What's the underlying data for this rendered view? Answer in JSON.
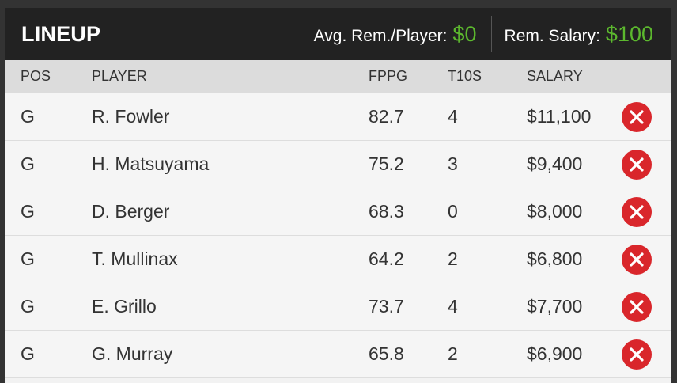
{
  "header": {
    "title": "LINEUP",
    "avg_label": "Avg. Rem./Player:",
    "avg_value": "$0",
    "rem_label": "Rem. Salary:",
    "rem_value": "$100",
    "accent_color": "#5cb82e"
  },
  "columns": {
    "pos": "POS",
    "player": "PLAYER",
    "fppg": "FPPG",
    "t10s": "T10S",
    "salary": "SALARY"
  },
  "rows": [
    {
      "pos": "G",
      "player": "R. Fowler",
      "fppg": "82.7",
      "t10s": "4",
      "salary": "$11,100"
    },
    {
      "pos": "G",
      "player": "H. Matsuyama",
      "fppg": "75.2",
      "t10s": "3",
      "salary": "$9,400"
    },
    {
      "pos": "G",
      "player": "D. Berger",
      "fppg": "68.3",
      "t10s": "0",
      "salary": "$8,000"
    },
    {
      "pos": "G",
      "player": "T. Mullinax",
      "fppg": "64.2",
      "t10s": "2",
      "salary": "$6,800"
    },
    {
      "pos": "G",
      "player": "E. Grillo",
      "fppg": "73.7",
      "t10s": "4",
      "salary": "$7,700"
    },
    {
      "pos": "G",
      "player": "G. Murray",
      "fppg": "65.8",
      "t10s": "2",
      "salary": "$6,900"
    }
  ],
  "icons": {
    "remove": "remove-x-circle-icon",
    "remove_color": "#d9262b"
  }
}
